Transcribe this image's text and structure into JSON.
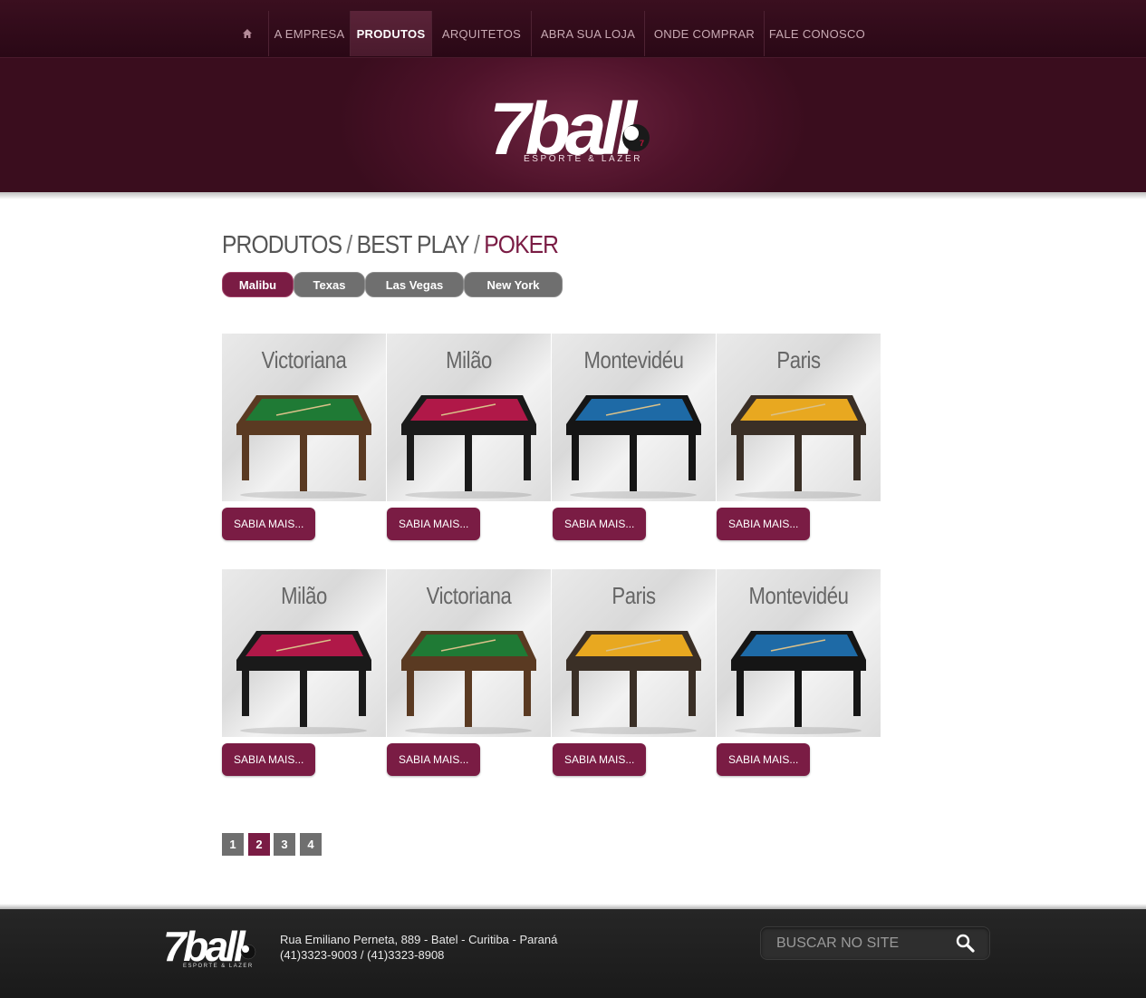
{
  "nav": {
    "items": [
      {
        "label": ""
      },
      {
        "label": "A EMPRESA"
      },
      {
        "label": "PRODUTOS"
      },
      {
        "label": "ARQUITETOS"
      },
      {
        "label": "ABRA SUA LOJA"
      },
      {
        "label": "ONDE COMPRAR"
      },
      {
        "label": "FALE CONOSCO"
      }
    ],
    "active": "PRODUTOS"
  },
  "logo": {
    "brand": "7ball",
    "tagline": "ESPORTE & LAZER",
    "ball_number": "7"
  },
  "breadcrumb": {
    "part1": "PRODUTOS",
    "part2": "BEST PLAY",
    "current": "POKER",
    "separator": "/"
  },
  "tabs": [
    {
      "label": "Malibu",
      "active": true
    },
    {
      "label": "Texas",
      "active": false
    },
    {
      "label": "Las Vegas",
      "active": false
    },
    {
      "label": "New York",
      "active": false
    }
  ],
  "products": [
    {
      "name": "Victoriana",
      "felt": "#1f7a35",
      "wood": "#5a3a22",
      "button": "SABIA MAIS..."
    },
    {
      "name": "Milão",
      "felt": "#b01848",
      "wood": "#1a1a1a",
      "button": "SABIA MAIS..."
    },
    {
      "name": "Montevidéu",
      "felt": "#1e6aa6",
      "wood": "#151515",
      "button": "SABIA MAIS..."
    },
    {
      "name": "Paris",
      "felt": "#e8a820",
      "wood": "#3a2f26",
      "button": "SABIA MAIS..."
    },
    {
      "name": "Milão",
      "felt": "#b01848",
      "wood": "#1a1a1a",
      "button": "SABIA MAIS..."
    },
    {
      "name": "Victoriana",
      "felt": "#1f7a35",
      "wood": "#5a3a22",
      "button": "SABIA MAIS..."
    },
    {
      "name": "Paris",
      "felt": "#e8a820",
      "wood": "#3a2f26",
      "button": "SABIA MAIS..."
    },
    {
      "name": "Montevidéu",
      "felt": "#1e6aa6",
      "wood": "#151515",
      "button": "SABIA MAIS..."
    }
  ],
  "pagination": {
    "pages": [
      "1",
      "2",
      "3",
      "4"
    ],
    "current": "2"
  },
  "footer": {
    "address": "Rua Emiliano Perneta, 889 - Batel - Curitiba - Paraná",
    "phones": "(41)3323-9003 / (41)3323-8908",
    "search_placeholder": "BUSCAR NO SITE"
  },
  "colors": {
    "brand": "#7a1c44",
    "nav_bg": "#2a0816",
    "header_bg": "#4d1229",
    "footer_bg": "#1f1f1f",
    "tab_inactive": "#6f6f6f"
  },
  "icons": {
    "home": "home-icon",
    "search": "search-icon"
  }
}
